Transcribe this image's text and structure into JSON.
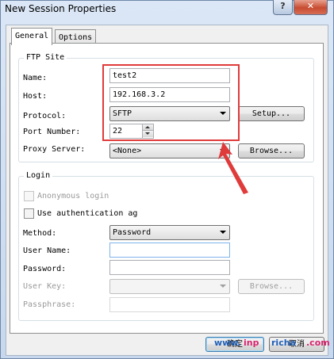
{
  "window": {
    "title": "New Session Properties",
    "help_glyph": "?",
    "close_glyph": "✕"
  },
  "tabs": [
    {
      "label": "General",
      "active": true
    },
    {
      "label": "Options",
      "active": false
    }
  ],
  "ftp_site": {
    "group_title": "FTP Site",
    "name_label": "Name:",
    "name_value": "test2",
    "host_label": "Host:",
    "host_value": "192.168.3.2",
    "protocol_label": "Protocol:",
    "protocol_value": "SFTP",
    "setup_button": "Setup...",
    "port_label": "Port Number:",
    "port_value": "22",
    "proxy_label": "Proxy Server:",
    "proxy_value": "<None>",
    "browse_button": "Browse..."
  },
  "login": {
    "group_title": "Login",
    "anonymous_label": "Anonymous login",
    "anonymous_checked": false,
    "use_auth_label": "Use authentication ag",
    "use_auth_checked": false,
    "method_label": "Method:",
    "method_value": "Password",
    "username_label": "User Name:",
    "username_value": "",
    "password_label": "Password:",
    "password_value": "",
    "userkey_label": "User Key:",
    "userkey_value": "",
    "userkey_browse_button": "Browse...",
    "passphrase_label": "Passphrase:",
    "passphrase_value": ""
  },
  "footer": {
    "ok_button": "确定",
    "cancel_button": "取消",
    "watermark_left": "www.",
    "watermark_mid": "inp",
    "watermark_right": "richa",
    "watermark_end": ".com"
  },
  "colors": {
    "annotation": "#e03b3b",
    "watermark_blue": "#1f5fb8",
    "watermark_pink": "#d6246e"
  }
}
